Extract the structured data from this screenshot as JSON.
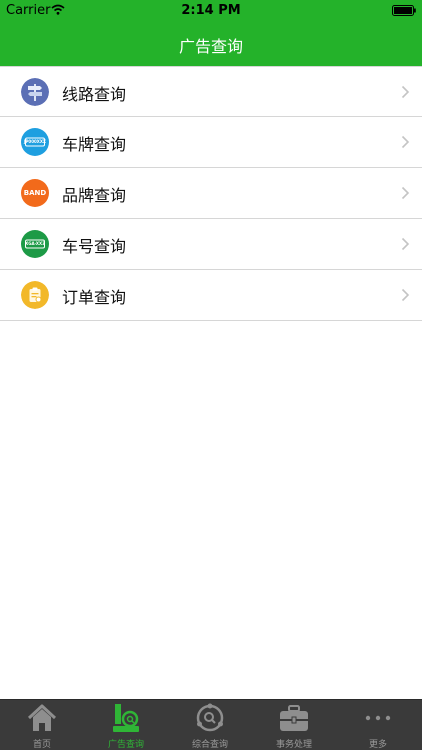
{
  "status_bar": {
    "carrier": "Carrier",
    "time": "2:14 PM"
  },
  "nav": {
    "title": "广告查询"
  },
  "menu": [
    {
      "label": "线路查询",
      "icon": "signpost-icon",
      "color": "#5b6fb5"
    },
    {
      "label": "车牌查询",
      "icon": "license-plate-icon",
      "color": "#1e9fe0",
      "icon_text": "JP000XXX"
    },
    {
      "label": "品牌查询",
      "icon": "brand-icon",
      "color": "#f26a1b",
      "icon_text": "BAND"
    },
    {
      "label": "车号查询",
      "icon": "bus-number-icon",
      "color": "#1d9a46",
      "icon_text": "XGA-XX3"
    },
    {
      "label": "订单查询",
      "icon": "order-clipboard-icon",
      "color": "#f2b829"
    }
  ],
  "tabs": [
    {
      "label": "首页",
      "icon": "home-icon",
      "active": false
    },
    {
      "label": "广告查询",
      "icon": "ad-search-icon",
      "active": true
    },
    {
      "label": "综合查询",
      "icon": "combined-search-icon",
      "active": false
    },
    {
      "label": "事务处理",
      "icon": "briefcase-icon",
      "active": false
    },
    {
      "label": "更多",
      "icon": "more-icon",
      "active": false
    }
  ],
  "colors": {
    "nav_green": "#24b22a",
    "tab_active": "#2fb536",
    "tab_bar_bg": "#3a3a3a"
  }
}
